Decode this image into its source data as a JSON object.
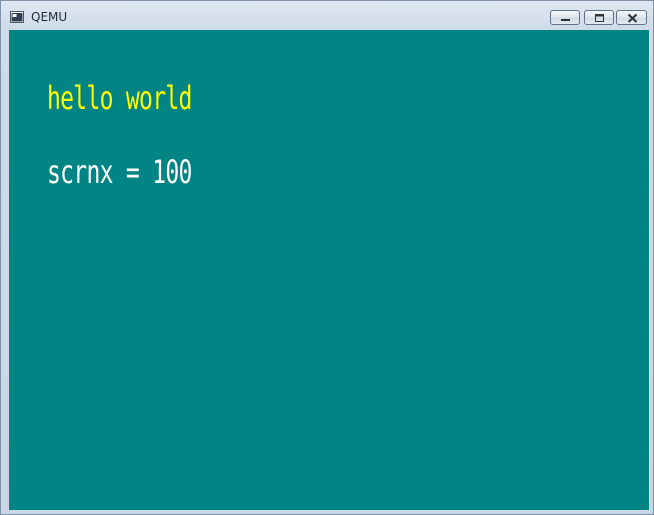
{
  "window": {
    "title": "QEMU",
    "controls": {
      "minimize_icon": "minimize-icon",
      "maximize_icon": "maximize-icon",
      "close_icon": "close-icon"
    }
  },
  "screen": {
    "background": "#008484",
    "lines": [
      {
        "text": "hello world",
        "color": "#ffff00"
      },
      {
        "text": "scrnx = 100",
        "color": "#ffffff"
      }
    ]
  }
}
